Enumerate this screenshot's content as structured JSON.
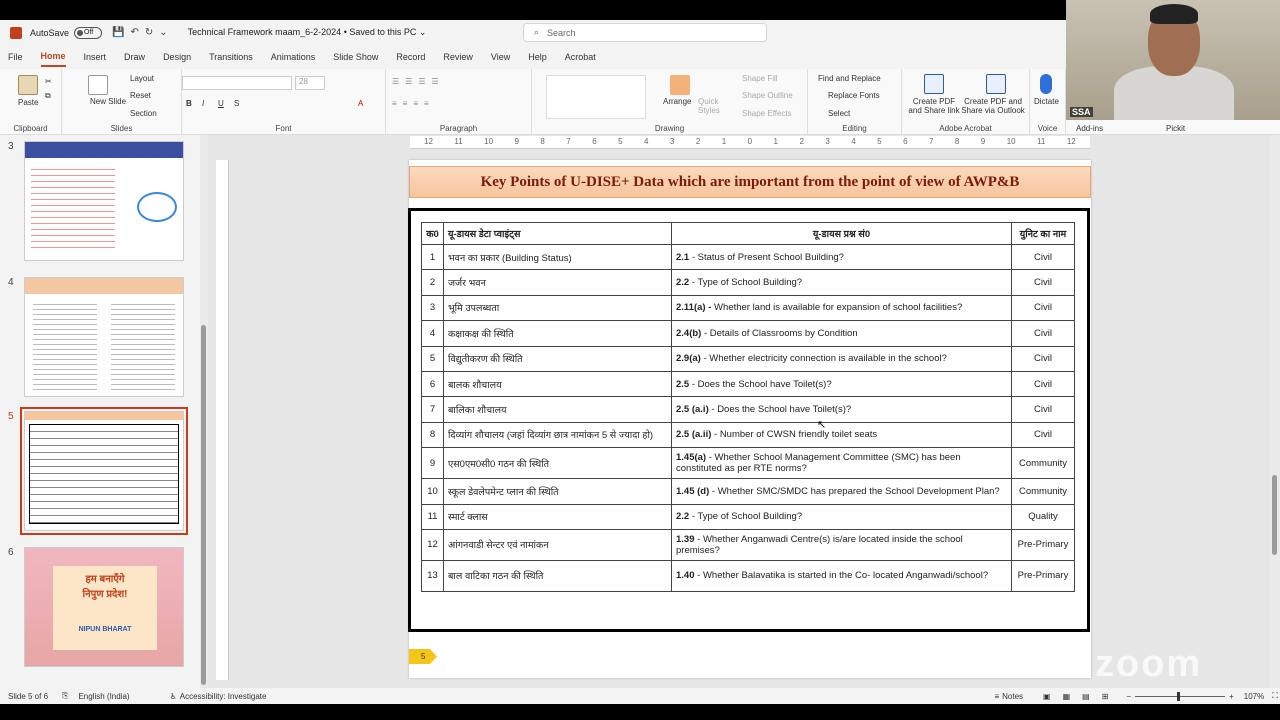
{
  "titlebar": {
    "autosave_label": "AutoSave",
    "autosave_state": "Off",
    "doc_title": "Technical Framework maam_6-2-2024 • Saved to this PC ⌄",
    "search_placeholder": "Search"
  },
  "menu": [
    "File",
    "Home",
    "Insert",
    "Draw",
    "Design",
    "Transitions",
    "Animations",
    "Slide Show",
    "Record",
    "Review",
    "View",
    "Help",
    "Acrobat"
  ],
  "ribbon": {
    "clipboard": {
      "paste": "Paste",
      "label": "Clipboard"
    },
    "slides": {
      "new_slide": "New Slide",
      "layout": "Layout",
      "reset": "Reset",
      "section": "Section",
      "label": "Slides"
    },
    "font": {
      "size": "28",
      "label": "Font"
    },
    "paragraph": {
      "label": "Paragraph"
    },
    "drawing": {
      "arrange": "Arrange",
      "quick_styles": "Quick Styles",
      "shape_fill": "Shape Fill",
      "shape_outline": "Shape Outline",
      "shape_effects": "Shape Effects",
      "label": "Drawing"
    },
    "editing": {
      "find": "Find and Replace",
      "replace": "Replace Fonts",
      "select": "Select",
      "label": "Editing"
    },
    "acrobat": {
      "pdf_link": "Create PDF and Share link",
      "pdf_outlook": "Create PDF and Share via Outlook",
      "label": "Adobe Acrobat"
    },
    "voice": {
      "dictate": "Dictate",
      "label": "Voice"
    },
    "addins": {
      "label": "Add-ins"
    },
    "pickit": {
      "label": "Pickit"
    }
  },
  "thumbnails": [
    {
      "num": "3"
    },
    {
      "num": "4"
    },
    {
      "num": "5"
    },
    {
      "num": "6",
      "text1": "हम बनाएँगे",
      "text2": "निपुण प्रदेश!",
      "text3": "NIPUN BHARAT"
    }
  ],
  "ruler": [
    "12",
    "11",
    "10",
    "9",
    "8",
    "7",
    "6",
    "5",
    "4",
    "3",
    "2",
    "1",
    "0",
    "1",
    "2",
    "3",
    "4",
    "5",
    "6",
    "7",
    "8",
    "9",
    "10",
    "11",
    "12"
  ],
  "slide": {
    "title": "Key Points of U-DISE+ Data which are important from the point of view of AWP&B",
    "page_number": "5",
    "table": {
      "headers": [
        "क0",
        "यू-डायस डेटा प्वाइंट्स",
        "यू-डायस प्रश्न सं0",
        "युनिट का नाम"
      ],
      "rows": [
        {
          "n": "1",
          "point": "भवन का प्रकार (Building Status)",
          "code": "2.1",
          "q": " - Status of Present School Building?",
          "unit": "Civil"
        },
        {
          "n": "2",
          "point": "जर्जर भवन",
          "code": "2.2",
          "q": " - Type of School Building?",
          "unit": "Civil"
        },
        {
          "n": "3",
          "point": "भूमि उपलब्धता",
          "code": "2.11(a) -",
          "q": " Whether land is available for expansion of school facilities?",
          "unit": "Civil"
        },
        {
          "n": "4",
          "point": "कक्षाकक्ष की स्थिति",
          "code": "2.4(b)",
          "q": " - Details of Classrooms by Condition",
          "unit": "Civil"
        },
        {
          "n": "5",
          "point": "विद्युतीकरण की स्थिति",
          "code": "2.9(a)",
          "q": " - Whether electricity connection is available in the school?",
          "unit": "Civil"
        },
        {
          "n": "6",
          "point": "बालक शौचालय",
          "code": "2.5",
          "q": " - Does the School have Toilet(s)?",
          "unit": "Civil"
        },
        {
          "n": "7",
          "point": "बालिका शौचालय",
          "code": "2.5 (a.i)",
          "q": " - Does the School have Toilet(s)?",
          "unit": "Civil"
        },
        {
          "n": "8",
          "point": "दिव्यांग शौचालय (जहां दिव्यांग छात्र नामांकन 5 से ज्यादा हो)",
          "code": "2.5 (a.ii)",
          "q": " - Number of CWSN friendly toilet seats",
          "unit": "Civil"
        },
        {
          "n": "9",
          "point": "एस0एम0सी0 गठन की स्थिति",
          "code": "1.45(a)",
          "q": " - Whether School Management Committee (SMC) has been constituted as per RTE norms?",
          "unit": "Community"
        },
        {
          "n": "10",
          "point": "स्कूल डेवलेपमेन्ट प्लान की स्थिति",
          "code": "1.45 (d)",
          "q": " - Whether SMC/SMDC has prepared the School Development Plan?",
          "unit": "Community"
        },
        {
          "n": "11",
          "point": "स्मार्ट क्लास",
          "code": "2.2",
          "q": " - Type of School Building?",
          "unit": "Quality"
        },
        {
          "n": "12",
          "point": "आंगनवाडी सेन्टर एवं नामांकन",
          "code": "1.39",
          "q": " - Whether Anganwadi Centre(s) is/are located inside the school premises?",
          "unit": "Pre-Primary"
        },
        {
          "n": "13",
          "point": "बाल वाटिका गठन की स्थिति",
          "code": "1.40",
          "q": " - Whether Balavatika is started in the Co- located Anganwadi/school?",
          "unit": "Pre-Primary"
        }
      ]
    }
  },
  "status": {
    "slide": "Slide 5 of 6",
    "language": "English (India)",
    "accessibility": "Accessibility: Investigate",
    "notes": "Notes",
    "zoom": "107%"
  },
  "video": {
    "name": "SSA",
    "watermark": "zoom"
  },
  "colors": {
    "accent": "#b7472a",
    "title_text": "#7b1c06",
    "selection": "#c43e1c"
  }
}
